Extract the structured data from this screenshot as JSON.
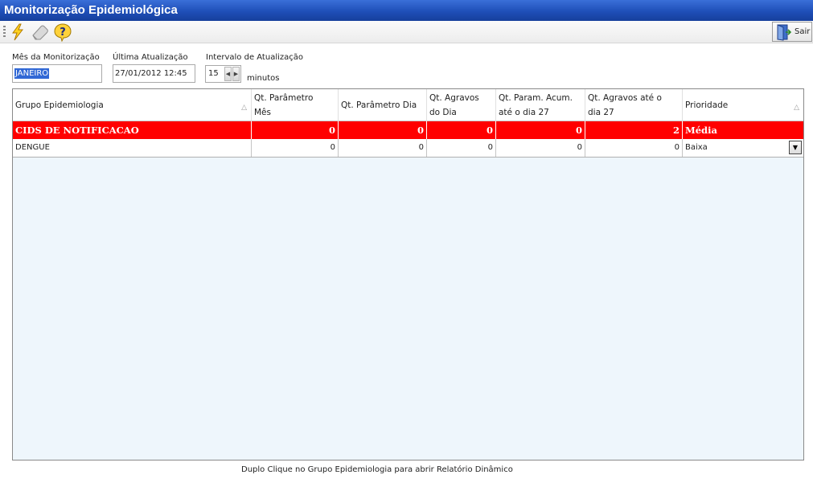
{
  "window": {
    "title": "Monitorização Epidemiológica"
  },
  "toolbar": {
    "execute_icon": "lightning-icon",
    "clear_icon": "eraser-icon",
    "help_icon": "help-icon",
    "exit_label": "Sair",
    "exit_icon": "exit-door-icon"
  },
  "filters": {
    "month_label": "Mês da Monitorização",
    "month_value": "JANEIRO",
    "last_update_label": "Última Atualização",
    "last_update_value": "27/01/2012 12:45",
    "interval_label": "Intervalo de Atualização",
    "interval_value": "15",
    "interval_unit": "minutos"
  },
  "grid": {
    "columns": [
      "Grupo Epidemiologia",
      "Qt. Parâmetro Mês",
      "Qt. Parâmetro Dia",
      "Qt. Agravos do Dia",
      "Qt. Param. Acum. até o dia 27",
      "Qt. Agravos até o dia 27",
      "Prioridade"
    ],
    "rows": [
      {
        "group": "CIDS DE NOTIFICACAO",
        "param_mes": "0",
        "param_dia": "0",
        "agravos_dia": "0",
        "param_acum": "0",
        "agravos_ate": "2",
        "prioridade": "Média",
        "highlight_color": "#ff0000"
      },
      {
        "group": "DENGUE",
        "param_mes": "0",
        "param_dia": "0",
        "agravos_dia": "0",
        "param_acum": "0",
        "agravos_ate": "0",
        "prioridade": "Baixa"
      }
    ]
  },
  "footer": {
    "hint": "Duplo Clique no Grupo Epidemiologia para abrir Relatório Dinâmico"
  },
  "colors": {
    "title_bar": "#1f4fb8",
    "alert_row": "#ff0000",
    "grid_bg": "#eef6fc",
    "selection": "#3168d5"
  }
}
